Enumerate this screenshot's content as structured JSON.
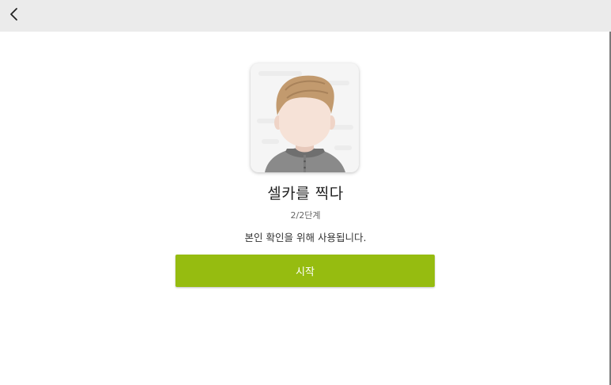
{
  "header": {
    "back_icon": "chevron-left-icon"
  },
  "avatar": {
    "icon": "selfie-person-avatar"
  },
  "main": {
    "title": "셀카를 찍다",
    "step": "2/2단계",
    "description": "본인 확인을 위해 사용됩니다.",
    "start_label": "시작"
  },
  "colors": {
    "topbar": "#ebebeb",
    "accent": "#96bc10",
    "hair": "#c29a6e",
    "skin": "#f6e2d7",
    "shirt": "#8a8a8a"
  }
}
